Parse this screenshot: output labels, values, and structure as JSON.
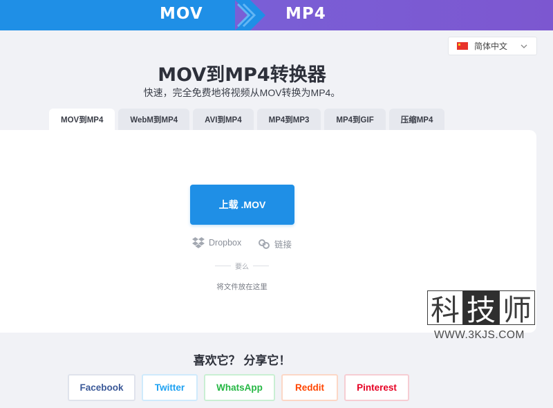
{
  "banner": {
    "from": "MOV",
    "to": "MP4"
  },
  "language": {
    "selected": "简体中文",
    "flag_color": "#e8332a"
  },
  "title": "MOV到MP4转换器",
  "subtitle": "快速，完全免费地将视频从MOV转换为MP4。",
  "tabs": [
    {
      "label": "MOV到MP4",
      "active": true
    },
    {
      "label": "WebM到MP4",
      "active": false
    },
    {
      "label": "AVI到MP4",
      "active": false
    },
    {
      "label": "MP4到MP3",
      "active": false
    },
    {
      "label": "MP4到GIF",
      "active": false
    },
    {
      "label": "压缩MP4",
      "active": false
    }
  ],
  "upload": {
    "label": "上载 .MOV"
  },
  "sources": {
    "dropbox": "Dropbox",
    "link": "链接"
  },
  "or_text": "要么",
  "drop_text": "将文件放在这里",
  "watermark": {
    "chars": [
      "科",
      "技",
      "师"
    ],
    "url": "WWW.3KJS.COM"
  },
  "share": {
    "title": "喜欢它？ 分享它！",
    "buttons": [
      "Facebook",
      "Twitter",
      "WhatsApp",
      "Reddit",
      "Pinterest"
    ]
  },
  "colors": {
    "primary": "#1f8fe6",
    "purple": "#7a5fd6",
    "background": "#f1f2f6"
  }
}
